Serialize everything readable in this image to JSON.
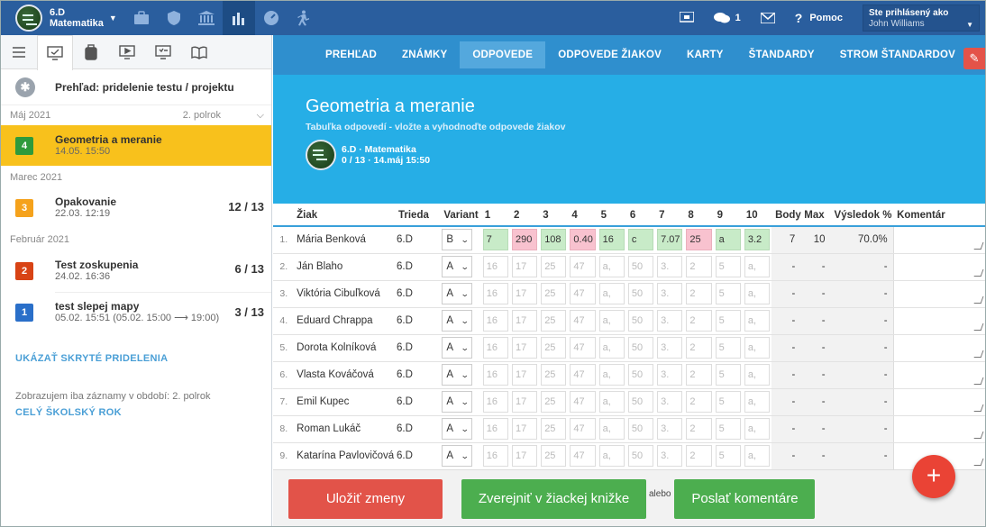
{
  "topbar": {
    "class_name": "6.D",
    "subject": "Matematika",
    "messages_count": "1",
    "help_label": "Pomoc",
    "logged_label": "Ste prihlásený ako",
    "user_name": "John Williams"
  },
  "sidebar": {
    "overview_label": "Prehľad: pridelenie testu / projektu",
    "groups": [
      {
        "month": "Máj 2021",
        "semester": "2. polrok",
        "items": [
          {
            "num": "4",
            "color": "#2e9a3c",
            "title": "Geometria a meranie",
            "date": "14.05. 15:50",
            "score": ""
          }
        ]
      },
      {
        "month": "Marec 2021",
        "items": [
          {
            "num": "3",
            "color": "#f5a21c",
            "title": "Opakovanie",
            "date": "22.03. 12:19",
            "score": "12 / 13"
          }
        ]
      },
      {
        "month": "Február 2021",
        "items": [
          {
            "num": "2",
            "color": "#d84315",
            "title": "Test zoskupenia",
            "date": "24.02. 16:36",
            "score": "6 / 13"
          },
          {
            "num": "1",
            "color": "#2a6fc9",
            "title": "test slepej mapy",
            "date": "05.02. 15:51 (05.02. 15:00 ⟶ 19:00)",
            "score": "3 / 13"
          }
        ]
      }
    ],
    "show_hidden": "UKÁZAŤ SKRYTÉ PRIDELENIA",
    "period_note": "Zobrazujem iba záznamy v období: 2. polrok",
    "whole_year": "CELÝ ŠKOLSKÝ ROK"
  },
  "subnav": [
    "PREHĽAD",
    "ZNÁMKY",
    "ODPOVEDE",
    "ODPOVEDE ŽIAKOV",
    "KARTY",
    "ŠTANDARDY",
    "STROM ŠTANDARDOV"
  ],
  "hero": {
    "title": "Geometria a meranie",
    "subtitle": "Tabuľka odpovedí - vložte a vyhodnoďte odpovede žiakov",
    "class_line": "6.D · Matematika",
    "stats_line": "0 / 13 · 14.máj 15:50"
  },
  "table": {
    "headers": [
      "Žiak",
      "Trieda",
      "Variant",
      "1",
      "2",
      "3",
      "4",
      "5",
      "6",
      "7",
      "8",
      "9",
      "10",
      "Body",
      "Max",
      "Výsledok %",
      "Komentár"
    ],
    "rows": [
      {
        "idx": "1.",
        "name": "Mária Benková",
        "cls": "6.D",
        "variant": "B",
        "answers": [
          "7",
          "290",
          "108",
          "0.40",
          "16",
          "c",
          "7.07",
          "25",
          "a",
          "3.2"
        ],
        "states": [
          "g",
          "r",
          "g",
          "r",
          "g",
          "g",
          "g",
          "r",
          "g",
          "g"
        ],
        "body": "7",
        "max": "10",
        "result": "70.0%"
      },
      {
        "idx": "2.",
        "name": "Ján Blaho",
        "cls": "6.D",
        "variant": "A",
        "answers": [
          "16",
          "17",
          "25",
          "47",
          "a,",
          "50",
          "3.",
          "2",
          "5",
          "a,"
        ],
        "states": [
          "",
          "",
          "",
          "",
          "",
          "",
          "",
          "",
          "",
          ""
        ],
        "body": "-",
        "max": "-",
        "result": "-"
      },
      {
        "idx": "3.",
        "name": "Viktória Cibuľková",
        "cls": "6.D",
        "variant": "A",
        "answers": [
          "16",
          "17",
          "25",
          "47",
          "a,",
          "50",
          "3.",
          "2",
          "5",
          "a,"
        ],
        "states": [
          "",
          "",
          "",
          "",
          "",
          "",
          "",
          "",
          "",
          ""
        ],
        "body": "-",
        "max": "-",
        "result": "-"
      },
      {
        "idx": "4.",
        "name": "Eduard Chrappa",
        "cls": "6.D",
        "variant": "A",
        "answers": [
          "16",
          "17",
          "25",
          "47",
          "a,",
          "50",
          "3.",
          "2",
          "5",
          "a,"
        ],
        "states": [
          "",
          "",
          "",
          "",
          "",
          "",
          "",
          "",
          "",
          ""
        ],
        "body": "-",
        "max": "-",
        "result": "-"
      },
      {
        "idx": "5.",
        "name": "Dorota Kolníková",
        "cls": "6.D",
        "variant": "A",
        "answers": [
          "16",
          "17",
          "25",
          "47",
          "a,",
          "50",
          "3.",
          "2",
          "5",
          "a,"
        ],
        "states": [
          "",
          "",
          "",
          "",
          "",
          "",
          "",
          "",
          "",
          ""
        ],
        "body": "-",
        "max": "-",
        "result": "-"
      },
      {
        "idx": "6.",
        "name": "Vlasta Kováčová",
        "cls": "6.D",
        "variant": "A",
        "answers": [
          "16",
          "17",
          "25",
          "47",
          "a,",
          "50",
          "3.",
          "2",
          "5",
          "a,"
        ],
        "states": [
          "",
          "",
          "",
          "",
          "",
          "",
          "",
          "",
          "",
          ""
        ],
        "body": "-",
        "max": "-",
        "result": "-"
      },
      {
        "idx": "7.",
        "name": "Emil Kupec",
        "cls": "6.D",
        "variant": "A",
        "answers": [
          "16",
          "17",
          "25",
          "47",
          "a,",
          "50",
          "3.",
          "2",
          "5",
          "a,"
        ],
        "states": [
          "",
          "",
          "",
          "",
          "",
          "",
          "",
          "",
          "",
          ""
        ],
        "body": "-",
        "max": "-",
        "result": "-"
      },
      {
        "idx": "8.",
        "name": "Roman Lukáč",
        "cls": "6.D",
        "variant": "A",
        "answers": [
          "16",
          "17",
          "25",
          "47",
          "a,",
          "50",
          "3.",
          "2",
          "5",
          "a,"
        ],
        "states": [
          "",
          "",
          "",
          "",
          "",
          "",
          "",
          "",
          "",
          ""
        ],
        "body": "-",
        "max": "-",
        "result": "-"
      },
      {
        "idx": "9.",
        "name": "Katarína Pavlovičová",
        "cls": "6.D",
        "variant": "A",
        "answers": [
          "16",
          "17",
          "25",
          "47",
          "a,",
          "50",
          "3.",
          "2",
          "5",
          "a,"
        ],
        "states": [
          "",
          "",
          "",
          "",
          "",
          "",
          "",
          "",
          "",
          ""
        ],
        "body": "-",
        "max": "-",
        "result": "-"
      }
    ]
  },
  "footer": {
    "save": "Uložiť zmeny",
    "publish": "Zverejniť v žiackej knižke",
    "or": "alebo",
    "send": "Poslať komentáre"
  },
  "fab": "+"
}
